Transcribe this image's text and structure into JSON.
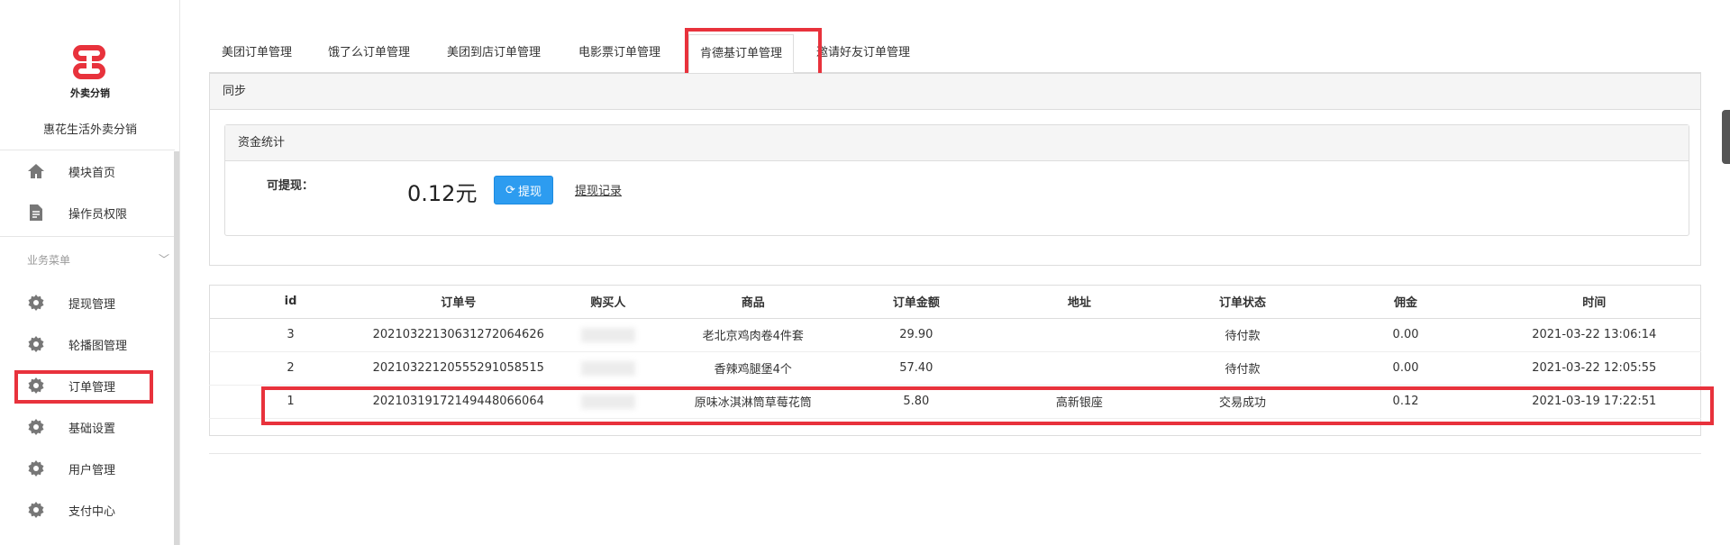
{
  "sidebar": {
    "logo_text": "外卖分销",
    "brand": "惠花生活外卖分销",
    "top_items": [
      {
        "label": "模块首页",
        "icon": "home-icon"
      },
      {
        "label": "操作员权限",
        "icon": "document-icon"
      }
    ],
    "section_title": "业务菜单",
    "menu_items": [
      {
        "label": "提现管理",
        "icon": "gear-icon"
      },
      {
        "label": "轮播图管理",
        "icon": "gear-icon"
      },
      {
        "label": "订单管理",
        "icon": "gear-icon"
      },
      {
        "label": "基础设置",
        "icon": "gear-icon"
      },
      {
        "label": "用户管理",
        "icon": "gear-icon"
      },
      {
        "label": "支付中心",
        "icon": "gear-icon"
      }
    ]
  },
  "tabs": [
    {
      "label": "美团订单管理"
    },
    {
      "label": "饿了么订单管理"
    },
    {
      "label": "美团到店订单管理"
    },
    {
      "label": "电影票订单管理"
    },
    {
      "label": "肯德基订单管理",
      "active": true
    },
    {
      "label": "邀请好友订单管理"
    }
  ],
  "sync_panel": {
    "title": "同步",
    "funds_title": "资金统计",
    "withdrawable_label": "可提现：",
    "amount": "0.12元",
    "withdraw_button": "提现",
    "withdraw_record_link": "提现记录"
  },
  "table": {
    "headers": [
      "id",
      "订单号",
      "购买人",
      "商品",
      "订单金额",
      "地址",
      "订单状态",
      "佣金",
      "时间"
    ],
    "rows": [
      {
        "id": "3",
        "order_no": "20210322130631272064626",
        "product": "老北京鸡肉卷4件套",
        "amount": "29.90",
        "address": "",
        "status": "待付款",
        "commission": "0.00",
        "time": "2021-03-22 13:06:14"
      },
      {
        "id": "2",
        "order_no": "20210322120555291058515",
        "product": "香辣鸡腿堡4个",
        "amount": "57.40",
        "address": "",
        "status": "待付款",
        "commission": "0.00",
        "time": "2021-03-22 12:05:55"
      },
      {
        "id": "1",
        "order_no": "20210319172149448066064",
        "product": "原味冰淇淋筒草莓花筒",
        "amount": "5.80",
        "address": "高新银座",
        "status": "交易成功",
        "commission": "0.12",
        "time": "2021-03-19 17:22:51"
      }
    ]
  },
  "colors": {
    "highlight": "#e8323c",
    "button": "#2d9cf0"
  }
}
